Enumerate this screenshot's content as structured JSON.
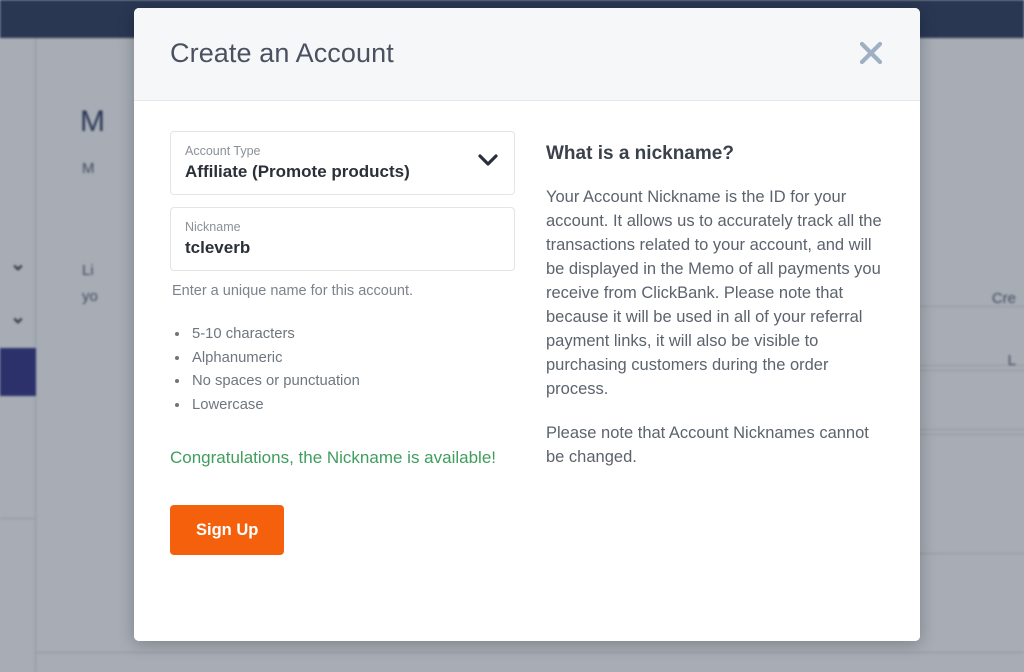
{
  "background": {
    "heading": "M",
    "subheading": "M",
    "paragraph_line_1": "Li",
    "paragraph_line_2": "yo",
    "footer_text": "",
    "card_1_label": "Cre",
    "card_2_label": "L"
  },
  "modal": {
    "title": "Create an Account",
    "close_icon": "close-icon",
    "form": {
      "account_type": {
        "label": "Account Type",
        "value": "Affiliate (Promote products)",
        "chevron_icon": "chevron-down-icon"
      },
      "nickname": {
        "label": "Nickname",
        "value": "tcleverb",
        "placeholder": "Nickname"
      },
      "hint": "Enter a unique name for this account.",
      "rules": [
        "5-10 characters",
        "Alphanumeric",
        "No spaces or punctuation",
        "Lowercase"
      ],
      "availability_message": "Congratulations, the Nickname is available!",
      "submit_label": "Sign Up"
    },
    "info": {
      "title": "What is a nickname?",
      "paragraph_1": "Your Account Nickname is the ID for your account. It allows us to accurately track all the transactions related to your account, and will be displayed in the Memo of all payments you receive from ClickBank. Please note that because it will be used in all of your referral payment links, it will also be visible to purchasing customers during the order process.",
      "paragraph_2": "Please note that Account Nicknames cannot be changed."
    }
  },
  "colors": {
    "accent_orange": "#f4600c",
    "success_green": "#3f9d5e",
    "topbar_navy": "#1b2a4e",
    "sidebar_active": "#1f1f7a"
  }
}
